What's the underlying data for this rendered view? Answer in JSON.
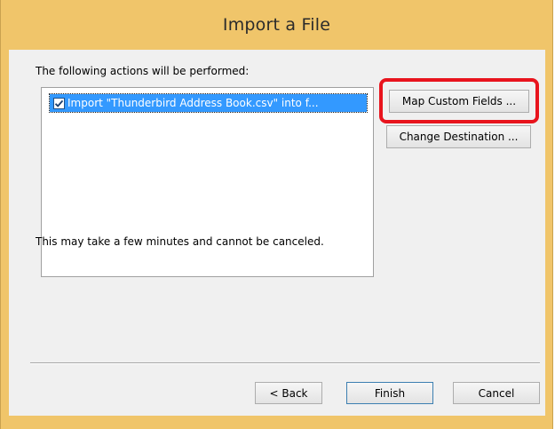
{
  "window": {
    "title": "Import a File",
    "frame_color": "#f0c56a"
  },
  "content": {
    "heading": "The following actions will be performed:",
    "actions": [
      {
        "checked": true,
        "label": "Import \"Thunderbird Address Book.csv\" into f..."
      }
    ],
    "note": "This may take a few minutes and cannot be canceled."
  },
  "buttons": {
    "map_custom_fields": "Map Custom Fields ...",
    "change_destination": "Change Destination ...",
    "back": "< Back",
    "finish": "Finish",
    "cancel": "Cancel"
  },
  "highlight_color": "#e8141d",
  "selection_color": "#3399ff"
}
